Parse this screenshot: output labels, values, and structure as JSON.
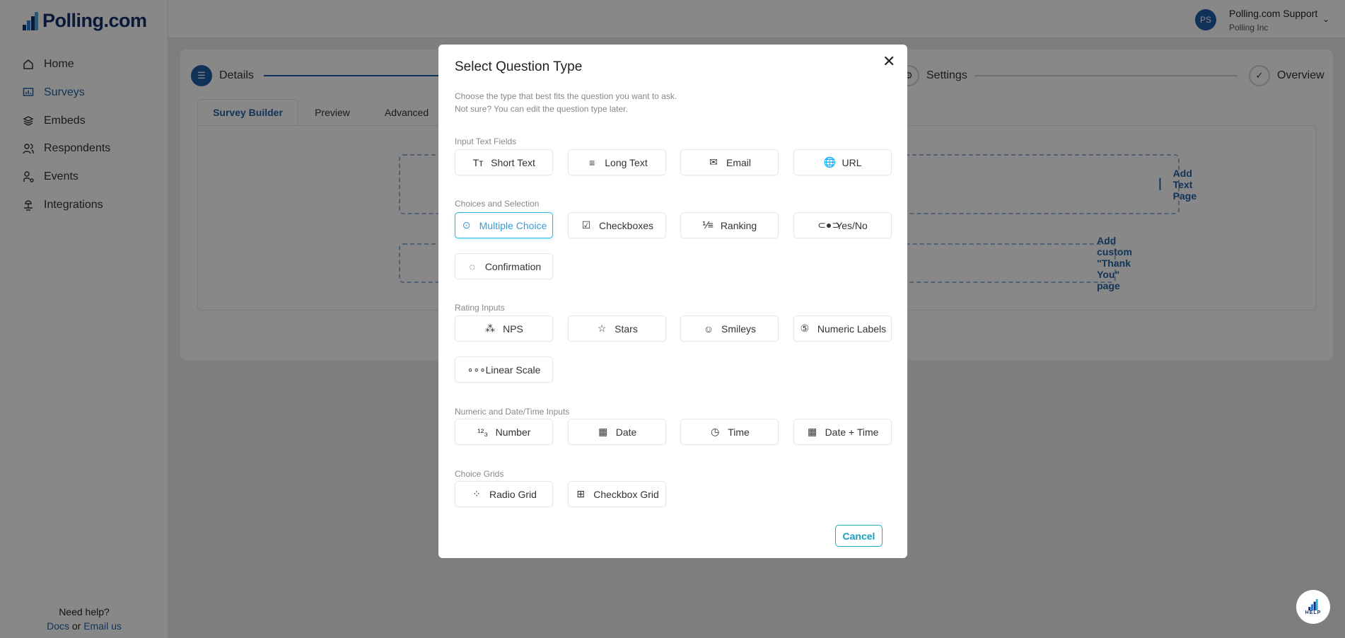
{
  "app": {
    "logo": "Polling.com",
    "brand_color": "#16306b",
    "accent": "#1e5fa8"
  },
  "sidebar": {
    "items": [
      {
        "label": "Home",
        "icon": "home-icon"
      },
      {
        "label": "Surveys",
        "icon": "survey-chart-icon",
        "active": true
      },
      {
        "label": "Embeds",
        "icon": "layers-icon"
      },
      {
        "label": "Respondents",
        "icon": "users-icon"
      },
      {
        "label": "Events",
        "icon": "events-icon"
      },
      {
        "label": "Integrations",
        "icon": "integrations-icon"
      }
    ],
    "help": {
      "title": "Need help?",
      "docs": "Docs",
      "or": "or",
      "email": "Email us"
    }
  },
  "header": {
    "avatar_initials": "PS",
    "user_name": "Polling.com Support",
    "org": "Polling Inc"
  },
  "steps": [
    {
      "label": "Details",
      "active": true
    },
    {
      "label": "Settings"
    },
    {
      "label": "Overview"
    }
  ],
  "tabs": [
    {
      "label": "Survey Builder",
      "active": true
    },
    {
      "label": "Preview"
    },
    {
      "label": "Advanced"
    }
  ],
  "builder": {
    "add_text_page": "Add Text Page",
    "add_thank_you": "Add custom \"Thank You\" page"
  },
  "help_fab": {
    "label": "HELP"
  },
  "modal": {
    "title": "Select Question Type",
    "desc_1": "Choose the type that best fits the question you want to ask.",
    "desc_2": "Not sure? You can edit the question type later.",
    "cancel": "Cancel",
    "sections": [
      {
        "label": "Input Text Fields",
        "items": [
          {
            "label": "Short Text",
            "icon": "Tт"
          },
          {
            "label": "Long Text",
            "icon": "≡"
          },
          {
            "label": "Email",
            "icon": "✉"
          },
          {
            "label": "URL",
            "icon": "🌐"
          }
        ]
      },
      {
        "label": "Choices and Selection",
        "items": [
          {
            "label": "Multiple Choice",
            "icon": "⊙",
            "selected": true
          },
          {
            "label": "Checkboxes",
            "icon": "☑"
          },
          {
            "label": "Ranking",
            "icon": "⅟≡"
          },
          {
            "label": "Yes/No",
            "icon": "⊂●⊃"
          },
          {
            "label": "Confirmation",
            "icon": "◌"
          }
        ]
      },
      {
        "label": "Rating Inputs",
        "items": [
          {
            "label": "NPS",
            "icon": "⁂"
          },
          {
            "label": "Stars",
            "icon": "☆"
          },
          {
            "label": "Smileys",
            "icon": "☺"
          },
          {
            "label": "Numeric Labels",
            "icon": "⑤"
          },
          {
            "label": "Linear Scale",
            "icon": "∘∘∘"
          }
        ]
      },
      {
        "label": "Numeric and Date/Time Inputs",
        "items": [
          {
            "label": "Number",
            "icon": "¹²₃"
          },
          {
            "label": "Date",
            "icon": "▦"
          },
          {
            "label": "Time",
            "icon": "◷"
          },
          {
            "label": "Date + Time",
            "icon": "▦"
          }
        ]
      },
      {
        "label": "Choice Grids",
        "items": [
          {
            "label": "Radio Grid",
            "icon": "⁘"
          },
          {
            "label": "Checkbox Grid",
            "icon": "⊞"
          }
        ]
      }
    ]
  }
}
